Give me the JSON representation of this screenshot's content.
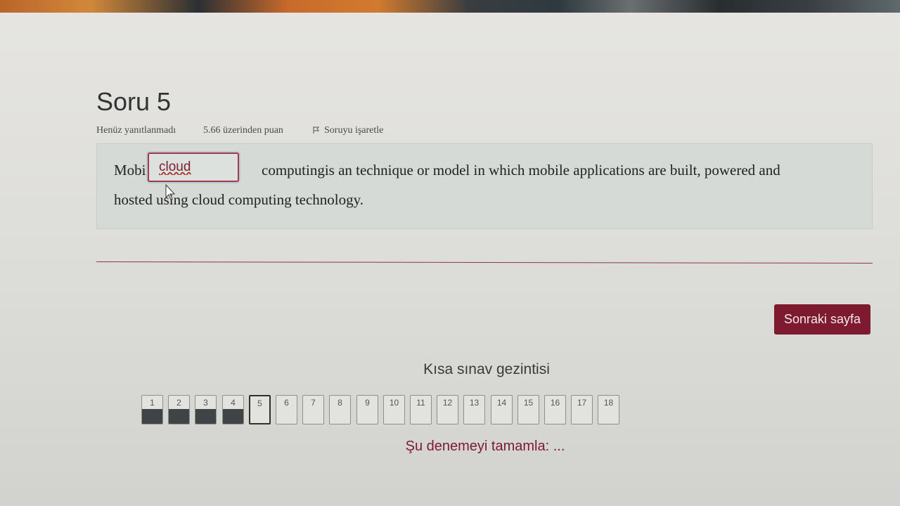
{
  "question": {
    "title": "Soru 5",
    "state": "Henüz yanıtlanmadı",
    "grade": "5.66 üzerinden puan",
    "flag_label": "Soruyu işaretle",
    "text_before": "Mobile",
    "answer_value": "cloud",
    "text_after_line1": "computingis an technique or model in which mobile applications are built, powered and",
    "text_line2": "hosted using cloud computing technology."
  },
  "next_button_label": "Sonraki sayfa",
  "navigation": {
    "title": "Kısa sınav gezintisi",
    "buttons": [
      {
        "label": "1",
        "state": "answered"
      },
      {
        "label": "2",
        "state": "answered"
      },
      {
        "label": "3",
        "state": "answered"
      },
      {
        "label": "4",
        "state": "answered"
      },
      {
        "label": "5",
        "state": "current"
      },
      {
        "label": "6",
        "state": "unanswered"
      },
      {
        "label": "7",
        "state": "unanswered"
      },
      {
        "label": "8",
        "state": "unanswered"
      },
      {
        "label": "9",
        "state": "unanswered"
      },
      {
        "label": "10",
        "state": "unanswered"
      },
      {
        "label": "11",
        "state": "unanswered"
      },
      {
        "label": "12",
        "state": "unanswered"
      },
      {
        "label": "13",
        "state": "unanswered"
      },
      {
        "label": "14",
        "state": "unanswered"
      },
      {
        "label": "15",
        "state": "unanswered"
      },
      {
        "label": "16",
        "state": "unanswered"
      },
      {
        "label": "17",
        "state": "unanswered"
      },
      {
        "label": "18",
        "state": "unanswered"
      }
    ],
    "finish_link": "Şu denemeyi tamamla: ..."
  },
  "colors": {
    "accent": "#7d1a30",
    "answered_fill": "#404447",
    "question_box": "#d5dad6"
  }
}
